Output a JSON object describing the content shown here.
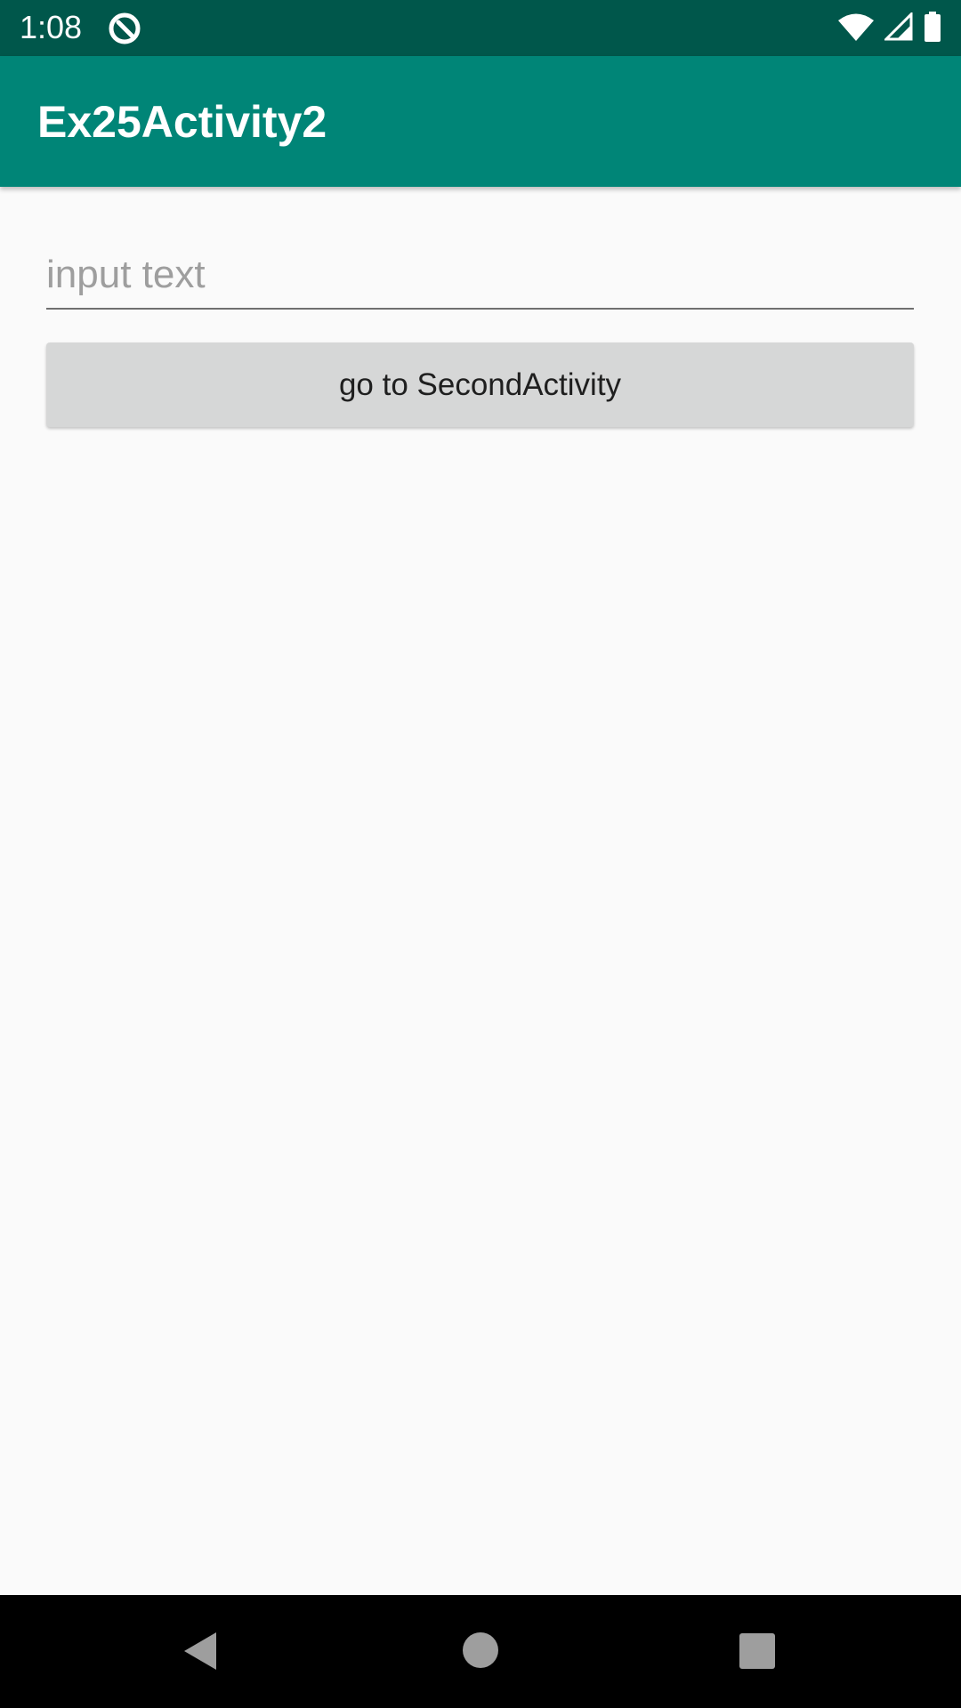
{
  "status_bar": {
    "time": "1:08",
    "icons": [
      "app-notification-icon",
      "wifi-icon",
      "signal-icon",
      "battery-icon"
    ],
    "background_color": "#00574b"
  },
  "app_bar": {
    "title": "Ex25Activity2",
    "background_color": "#008577"
  },
  "form": {
    "input_placeholder": "input text",
    "input_value": "",
    "button_label": "go to SecondActivity"
  },
  "nav_bar": {
    "buttons": [
      "back-icon",
      "home-icon",
      "recents-icon"
    ]
  }
}
